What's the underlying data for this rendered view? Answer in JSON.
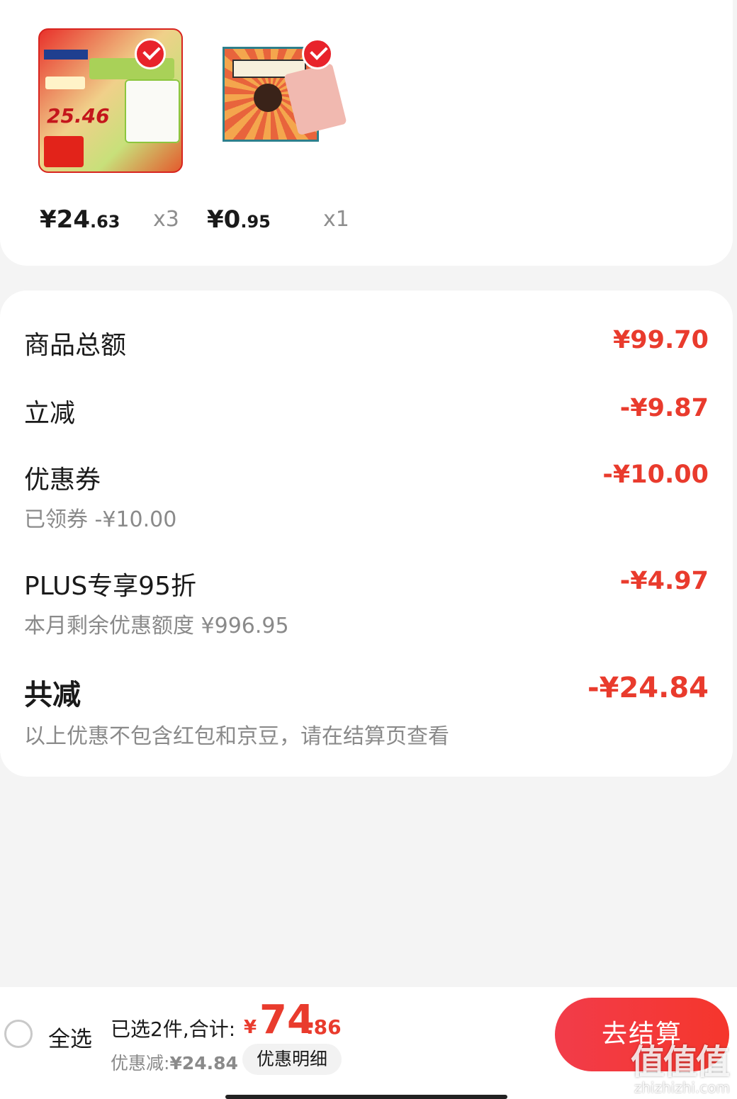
{
  "products": [
    {
      "price_int": "¥24",
      "price_dec": ".63",
      "qty": "x3",
      "thumb_price": "25.46"
    },
    {
      "price_int": "¥0",
      "price_dec": ".95",
      "qty": "x1"
    }
  ],
  "summary": {
    "goods_total_label": "商品总额",
    "goods_total_value": "¥99.70",
    "instant_off_label": "立减",
    "instant_off_value": "-¥9.87",
    "coupon_label": "优惠券",
    "coupon_value": "-¥10.00",
    "coupon_sub": "已领券 -¥10.00",
    "plus_label": "PLUS专享95折",
    "plus_value": "-¥4.97",
    "plus_sub": "本月剩余优惠额度 ¥996.95",
    "total_off_label": "共减",
    "total_off_value": "-¥24.84",
    "note": "以上优惠不包含红包和京豆，请在结算页查看"
  },
  "bottom_bar": {
    "select_all": "全选",
    "selected_text": "已选2件,合计:",
    "total_yen": "¥",
    "total_int": "74",
    "total_dec": ".86",
    "discount_text": "优惠减:",
    "discount_amount": "¥24.84",
    "detail_button": "优惠明细",
    "checkout_button": "去结算"
  },
  "watermark": {
    "glyphs": "值值值",
    "url": "zhizhizhi.com"
  },
  "colors": {
    "accent": "#e93b2d",
    "check": "#e8232b"
  },
  "icons": [
    "check-icon",
    "radio-icon"
  ]
}
